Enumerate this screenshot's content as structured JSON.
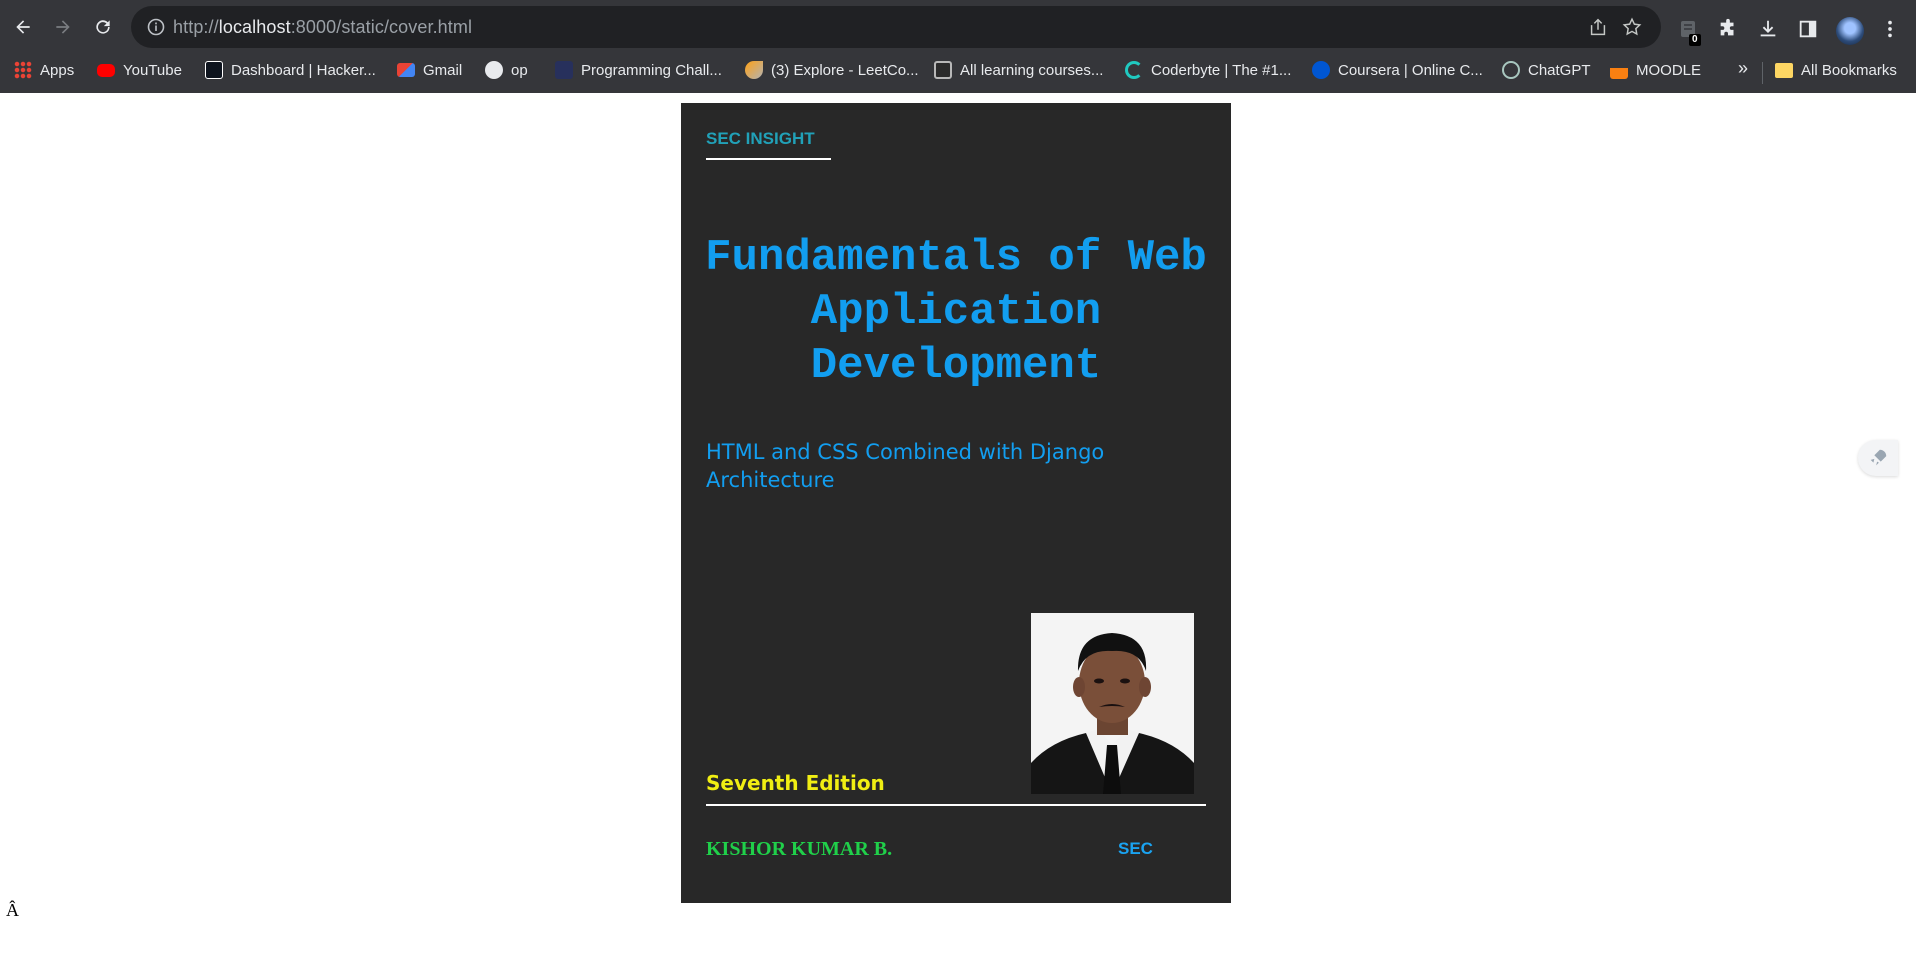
{
  "browser": {
    "url_scheme": "http://",
    "url_host": "localhost",
    "url_rest": ":8000/static/cover.html",
    "extension_badge": "0",
    "bookmarks": [
      {
        "label": "Apps",
        "icon": "apps-grid-icon",
        "color": "#4285f4"
      },
      {
        "label": "YouTube",
        "icon": "youtube-icon",
        "color": "#ff0000"
      },
      {
        "label": "Dashboard | Hacker...",
        "icon": "hackerrank-icon",
        "color": "#1ba94c"
      },
      {
        "label": "Gmail",
        "icon": "gmail-icon",
        "color": "#ea4335"
      },
      {
        "label": "op",
        "icon": "globe-icon",
        "color": "#e8eaed"
      },
      {
        "label": "Programming Chall...",
        "icon": "programming-icon",
        "color": "#3b4a8a"
      },
      {
        "label": "(3) Explore - LeetCo...",
        "icon": "leetcode-icon",
        "color": "#ffa116"
      },
      {
        "label": "All learning courses...",
        "icon": "cc-icon",
        "color": "#8a8a8a"
      },
      {
        "label": "Coderbyte | The #1...",
        "icon": "coderbyte-icon",
        "color": "#20c9c0"
      },
      {
        "label": "Coursera | Online C...",
        "icon": "coursera-icon",
        "color": "#0056d2"
      },
      {
        "label": "ChatGPT",
        "icon": "chatgpt-icon",
        "color": "#74aa9c"
      },
      {
        "label": "MOODLE",
        "icon": "moodle-icon",
        "color": "#f98012"
      }
    ],
    "more_label": "»",
    "all_bookmarks_label": "All Bookmarks"
  },
  "cover": {
    "brand": "SEC INSIGHT",
    "title": "Fundamentals of Web Application Development",
    "subtitle": "HTML and CSS Combined with Django Architecture",
    "edition": "Seventh Edition",
    "author": "KISHOR KUMAR B.",
    "publisher": "SEC",
    "colors": {
      "background": "#282828",
      "brand": "#21a1b8",
      "title": "#129ef0",
      "edition": "#f0ee13",
      "author": "#20d04a"
    }
  },
  "page": {
    "stray_char": "Â"
  }
}
